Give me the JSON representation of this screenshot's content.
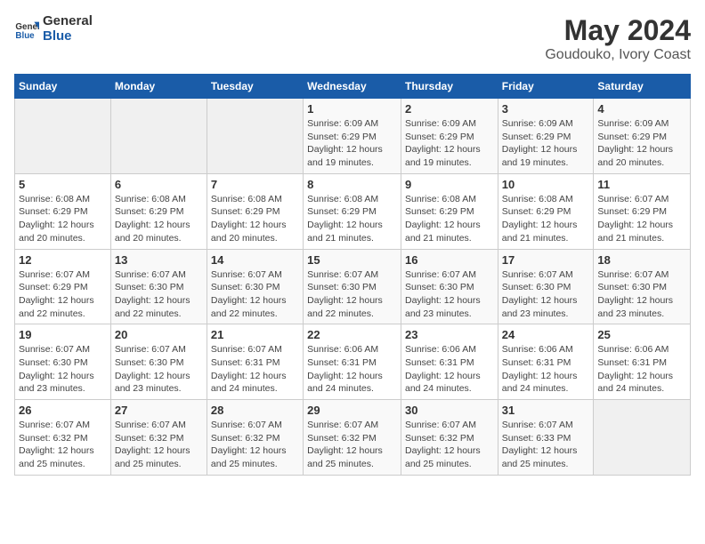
{
  "logo": {
    "text_general": "General",
    "text_blue": "Blue"
  },
  "title": {
    "month_year": "May 2024",
    "location": "Goudouko, Ivory Coast"
  },
  "weekdays": [
    "Sunday",
    "Monday",
    "Tuesday",
    "Wednesday",
    "Thursday",
    "Friday",
    "Saturday"
  ],
  "weeks": [
    [
      {
        "day": "",
        "info": ""
      },
      {
        "day": "",
        "info": ""
      },
      {
        "day": "",
        "info": ""
      },
      {
        "day": "1",
        "info": "Sunrise: 6:09 AM\nSunset: 6:29 PM\nDaylight: 12 hours\nand 19 minutes."
      },
      {
        "day": "2",
        "info": "Sunrise: 6:09 AM\nSunset: 6:29 PM\nDaylight: 12 hours\nand 19 minutes."
      },
      {
        "day": "3",
        "info": "Sunrise: 6:09 AM\nSunset: 6:29 PM\nDaylight: 12 hours\nand 19 minutes."
      },
      {
        "day": "4",
        "info": "Sunrise: 6:09 AM\nSunset: 6:29 PM\nDaylight: 12 hours\nand 20 minutes."
      }
    ],
    [
      {
        "day": "5",
        "info": "Sunrise: 6:08 AM\nSunset: 6:29 PM\nDaylight: 12 hours\nand 20 minutes."
      },
      {
        "day": "6",
        "info": "Sunrise: 6:08 AM\nSunset: 6:29 PM\nDaylight: 12 hours\nand 20 minutes."
      },
      {
        "day": "7",
        "info": "Sunrise: 6:08 AM\nSunset: 6:29 PM\nDaylight: 12 hours\nand 20 minutes."
      },
      {
        "day": "8",
        "info": "Sunrise: 6:08 AM\nSunset: 6:29 PM\nDaylight: 12 hours\nand 21 minutes."
      },
      {
        "day": "9",
        "info": "Sunrise: 6:08 AM\nSunset: 6:29 PM\nDaylight: 12 hours\nand 21 minutes."
      },
      {
        "day": "10",
        "info": "Sunrise: 6:08 AM\nSunset: 6:29 PM\nDaylight: 12 hours\nand 21 minutes."
      },
      {
        "day": "11",
        "info": "Sunrise: 6:07 AM\nSunset: 6:29 PM\nDaylight: 12 hours\nand 21 minutes."
      }
    ],
    [
      {
        "day": "12",
        "info": "Sunrise: 6:07 AM\nSunset: 6:29 PM\nDaylight: 12 hours\nand 22 minutes."
      },
      {
        "day": "13",
        "info": "Sunrise: 6:07 AM\nSunset: 6:30 PM\nDaylight: 12 hours\nand 22 minutes."
      },
      {
        "day": "14",
        "info": "Sunrise: 6:07 AM\nSunset: 6:30 PM\nDaylight: 12 hours\nand 22 minutes."
      },
      {
        "day": "15",
        "info": "Sunrise: 6:07 AM\nSunset: 6:30 PM\nDaylight: 12 hours\nand 22 minutes."
      },
      {
        "day": "16",
        "info": "Sunrise: 6:07 AM\nSunset: 6:30 PM\nDaylight: 12 hours\nand 23 minutes."
      },
      {
        "day": "17",
        "info": "Sunrise: 6:07 AM\nSunset: 6:30 PM\nDaylight: 12 hours\nand 23 minutes."
      },
      {
        "day": "18",
        "info": "Sunrise: 6:07 AM\nSunset: 6:30 PM\nDaylight: 12 hours\nand 23 minutes."
      }
    ],
    [
      {
        "day": "19",
        "info": "Sunrise: 6:07 AM\nSunset: 6:30 PM\nDaylight: 12 hours\nand 23 minutes."
      },
      {
        "day": "20",
        "info": "Sunrise: 6:07 AM\nSunset: 6:30 PM\nDaylight: 12 hours\nand 23 minutes."
      },
      {
        "day": "21",
        "info": "Sunrise: 6:07 AM\nSunset: 6:31 PM\nDaylight: 12 hours\nand 24 minutes."
      },
      {
        "day": "22",
        "info": "Sunrise: 6:06 AM\nSunset: 6:31 PM\nDaylight: 12 hours\nand 24 minutes."
      },
      {
        "day": "23",
        "info": "Sunrise: 6:06 AM\nSunset: 6:31 PM\nDaylight: 12 hours\nand 24 minutes."
      },
      {
        "day": "24",
        "info": "Sunrise: 6:06 AM\nSunset: 6:31 PM\nDaylight: 12 hours\nand 24 minutes."
      },
      {
        "day": "25",
        "info": "Sunrise: 6:06 AM\nSunset: 6:31 PM\nDaylight: 12 hours\nand 24 minutes."
      }
    ],
    [
      {
        "day": "26",
        "info": "Sunrise: 6:07 AM\nSunset: 6:32 PM\nDaylight: 12 hours\nand 25 minutes."
      },
      {
        "day": "27",
        "info": "Sunrise: 6:07 AM\nSunset: 6:32 PM\nDaylight: 12 hours\nand 25 minutes."
      },
      {
        "day": "28",
        "info": "Sunrise: 6:07 AM\nSunset: 6:32 PM\nDaylight: 12 hours\nand 25 minutes."
      },
      {
        "day": "29",
        "info": "Sunrise: 6:07 AM\nSunset: 6:32 PM\nDaylight: 12 hours\nand 25 minutes."
      },
      {
        "day": "30",
        "info": "Sunrise: 6:07 AM\nSunset: 6:32 PM\nDaylight: 12 hours\nand 25 minutes."
      },
      {
        "day": "31",
        "info": "Sunrise: 6:07 AM\nSunset: 6:33 PM\nDaylight: 12 hours\nand 25 minutes."
      },
      {
        "day": "",
        "info": ""
      }
    ]
  ]
}
